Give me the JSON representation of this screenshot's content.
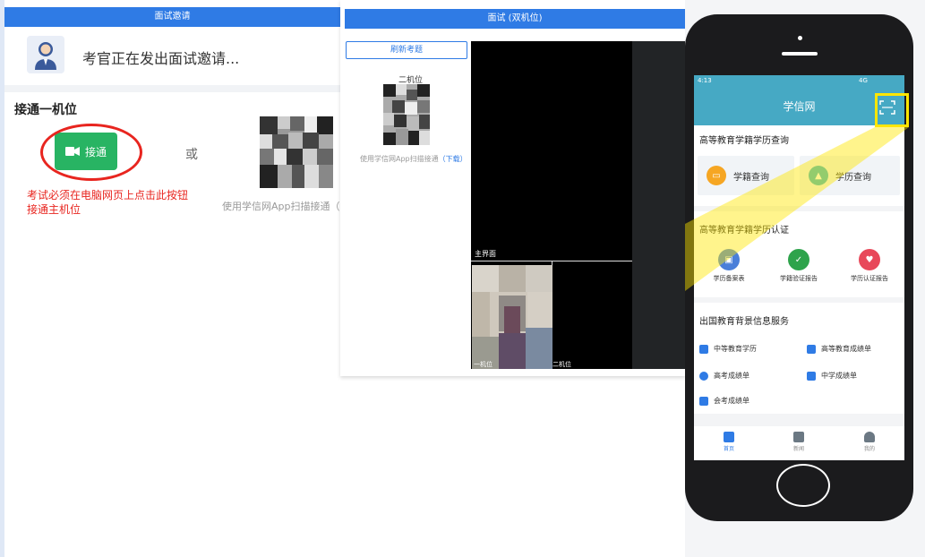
{
  "panel1": {
    "title": "面试邀请",
    "invite_text": "考官正在发出面试邀请...",
    "section_title": "接通一机位",
    "connect_button": "接通",
    "or_text": "或",
    "note_line1": "考试必须在电脑网页上点击此按钮",
    "note_line2": "接通主机位",
    "scan_text": "使用学信网App扫描接通（"
  },
  "panel2": {
    "title": "面试 (双机位)",
    "refresh_button": "刷新考题",
    "second_label": "二机位",
    "scan_text": "使用学信网App扫描接通",
    "download_link": "（下载）",
    "main_label": "主界面",
    "first_cam_label": "一机位",
    "second_cam_label": "二机位"
  },
  "phone": {
    "status_time": "4:13",
    "status_right": "4G",
    "app_title": "学信网",
    "section1_title": "高等教育学籍学历查询",
    "btn_xueji": "学籍查询",
    "btn_xueli": "学历查询",
    "section2_title": "高等教育学籍学历认证",
    "item_beian": "学历备案表",
    "item_yanzheng": "学籍验证报告",
    "item_renzheng": "学历认证报告",
    "section3_title": "出国教育背景信息服务",
    "svc1": "中等教育学历",
    "svc2": "高等教育成绩单",
    "svc3": "高考成绩单",
    "svc4": "中学成绩单",
    "svc5": "会考成绩单",
    "tab_home": "首页",
    "tab_news": "新闻",
    "tab_mine": "我的"
  },
  "colors": {
    "accent_blue": "#2f7be5",
    "green": "#28b463",
    "red": "#e8251f",
    "header_teal": "#46a9c4",
    "highlight_yellow": "#ffe600"
  }
}
